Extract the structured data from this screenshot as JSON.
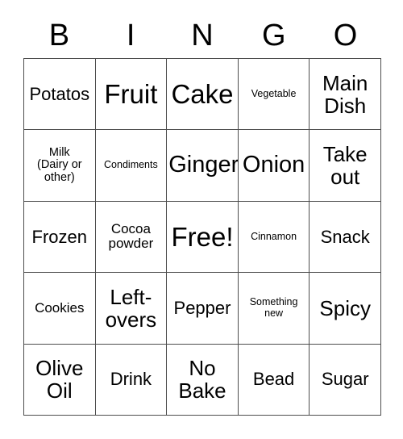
{
  "card": {
    "title": "BINGO",
    "header_letters": [
      "B",
      "I",
      "N",
      "G",
      "O"
    ],
    "grid_size": "5x5",
    "free_space": "Free!",
    "border_color": "#4d4d4d",
    "text_color": "#000000",
    "background_color": "#ffffff",
    "rows": [
      [
        {
          "label": "Potatos",
          "size": "md"
        },
        {
          "label": "Fruit",
          "size": "xxl"
        },
        {
          "label": "Cake",
          "size": "xxl"
        },
        {
          "label": "Vegetable",
          "size": "xxs"
        },
        {
          "label": "Main\nDish",
          "size": "lg"
        }
      ],
      [
        {
          "label": "Milk\n(Dairy or\nother)",
          "size": "xs"
        },
        {
          "label": "Condiments",
          "size": "xxs"
        },
        {
          "label": "Ginger",
          "size": "xl"
        },
        {
          "label": "Onion",
          "size": "xl"
        },
        {
          "label": "Take\nout",
          "size": "lg"
        }
      ],
      [
        {
          "label": "Frozen",
          "size": "md"
        },
        {
          "label": "Cocoa\npowder",
          "size": "sm"
        },
        {
          "label": "Free!",
          "size": "xxl"
        },
        {
          "label": "Cinnamon",
          "size": "xxs"
        },
        {
          "label": "Snack",
          "size": "md"
        }
      ],
      [
        {
          "label": "Cookies",
          "size": "sm"
        },
        {
          "label": "Left-\novers",
          "size": "lg"
        },
        {
          "label": "Pepper",
          "size": "md"
        },
        {
          "label": "Something\nnew",
          "size": "xxs"
        },
        {
          "label": "Spicy",
          "size": "lg"
        }
      ],
      [
        {
          "label": "Olive\nOil",
          "size": "lg"
        },
        {
          "label": "Drink",
          "size": "md"
        },
        {
          "label": "No\nBake",
          "size": "lg"
        },
        {
          "label": "Bead",
          "size": "md"
        },
        {
          "label": "Sugar",
          "size": "md"
        }
      ]
    ]
  }
}
